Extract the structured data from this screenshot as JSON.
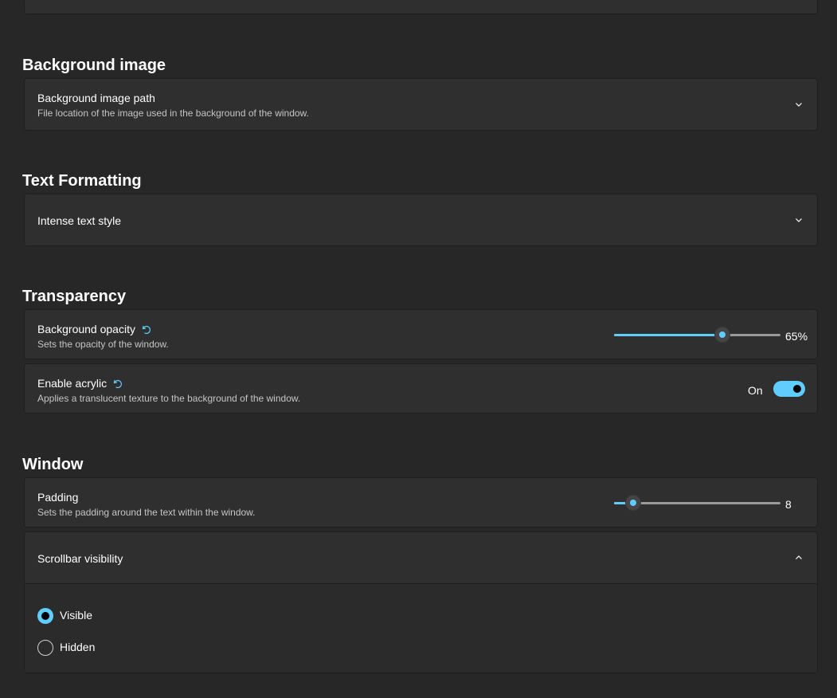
{
  "sections": {
    "background_image": {
      "title": "Background image",
      "path": {
        "label": "Background image path",
        "description": "File location of the image used in the background of the window."
      }
    },
    "text_formatting": {
      "title": "Text Formatting",
      "intense_style": {
        "label": "Intense text style"
      }
    },
    "transparency": {
      "title": "Transparency",
      "opacity": {
        "label": "Background opacity",
        "description": "Sets the opacity of the window.",
        "value_text": "65%",
        "value": 65,
        "min": 0,
        "max": 100
      },
      "acrylic": {
        "label": "Enable acrylic",
        "description": "Applies a translucent texture to the background of the window.",
        "state_text": "On",
        "enabled": true
      }
    },
    "window": {
      "title": "Window",
      "padding": {
        "label": "Padding",
        "description": "Sets the padding around the text within the window.",
        "value_text": "8",
        "value": 8,
        "min": 0,
        "max": 70
      },
      "scrollbar": {
        "label": "Scrollbar visibility",
        "options": [
          {
            "label": "Visible",
            "checked": true
          },
          {
            "label": "Hidden",
            "checked": false
          }
        ]
      }
    }
  },
  "icons": {
    "reset": "reset-icon",
    "chevron_down": "chevron-down-icon",
    "chevron_up": "chevron-up-icon"
  },
  "colors": {
    "accent": "#60cdff",
    "background": "#272727",
    "card": "#2f2f2f"
  }
}
